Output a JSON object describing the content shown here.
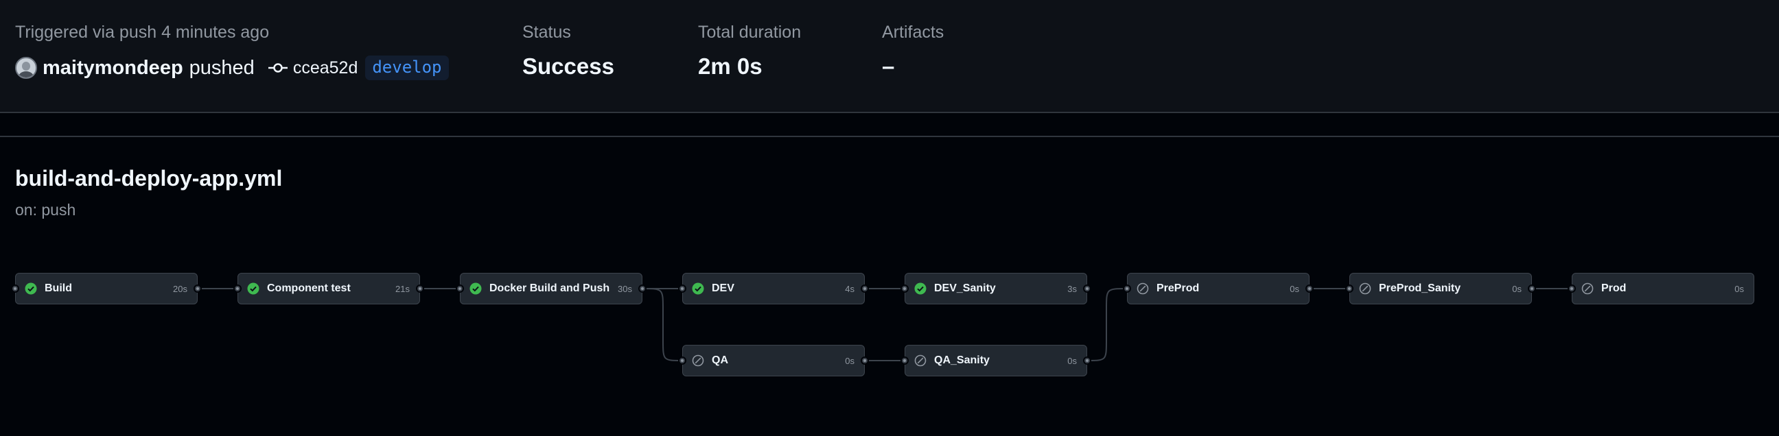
{
  "summary": {
    "trigger_text": "Triggered via push 4 minutes ago",
    "actor": "maitymondeep",
    "action": "pushed",
    "commit_sha": "ccea52d",
    "branch": "develop",
    "status_label": "Status",
    "status_value": "Success",
    "duration_label": "Total duration",
    "duration_value": "2m 0s",
    "artifacts_label": "Artifacts",
    "artifacts_value": "–"
  },
  "workflow": {
    "file": "build-and-deploy-app.yml",
    "trigger": "on: push"
  },
  "jobs": [
    {
      "name": "Build",
      "duration": "20s",
      "status": "success"
    },
    {
      "name": "Component test",
      "duration": "21s",
      "status": "success"
    },
    {
      "name": "Docker Build and Push",
      "duration": "30s",
      "status": "success"
    },
    {
      "name": "DEV",
      "duration": "4s",
      "status": "success"
    },
    {
      "name": "DEV_Sanity",
      "duration": "3s",
      "status": "success"
    },
    {
      "name": "PreProd",
      "duration": "0s",
      "status": "skipped"
    },
    {
      "name": "PreProd_Sanity",
      "duration": "0s",
      "status": "skipped"
    },
    {
      "name": "Prod",
      "duration": "0s",
      "status": "skipped"
    },
    {
      "name": "QA",
      "duration": "0s",
      "status": "skipped"
    },
    {
      "name": "QA_Sanity",
      "duration": "0s",
      "status": "skipped"
    }
  ],
  "colors": {
    "success": "#3fb950",
    "skipped": "#9198a1",
    "branch": "#4493f8"
  }
}
